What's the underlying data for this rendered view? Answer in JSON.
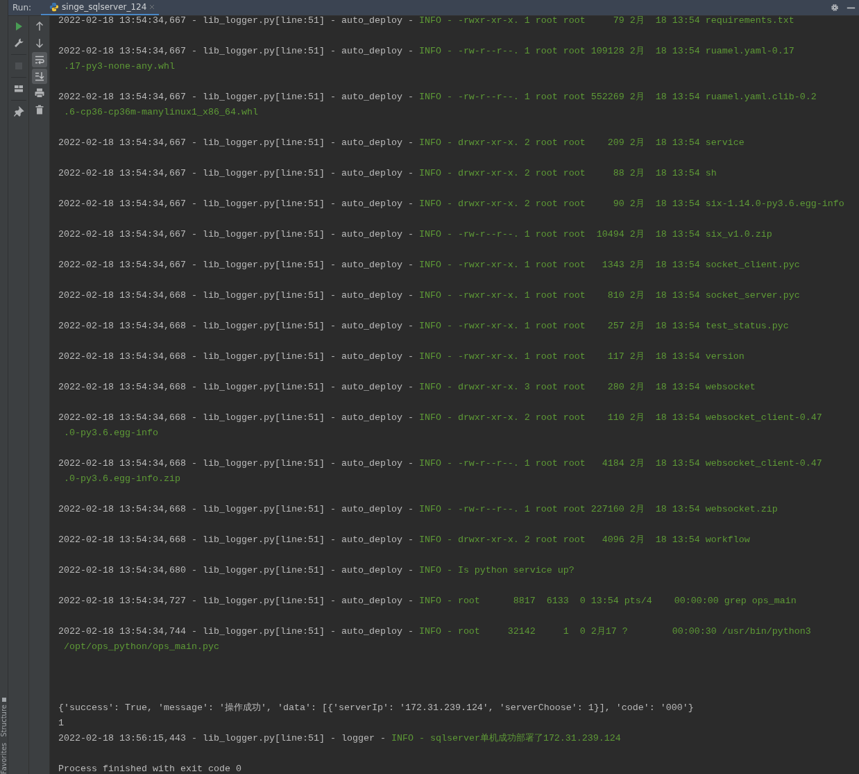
{
  "side_strip": {
    "items": [
      {
        "label": "Structure"
      },
      {
        "label": "Favorites"
      }
    ]
  },
  "run_bar": {
    "label": "Run:",
    "tabs": [
      {
        "label": "singe_sqlserver_124",
        "selected": true,
        "closable": true
      }
    ],
    "actions": [
      {
        "kind": "settings"
      },
      {
        "kind": "minimize"
      }
    ]
  },
  "toolbar_left": [
    {
      "kind": "rerun",
      "disabled": false
    },
    {
      "kind": "wrench",
      "disabled": false
    },
    {
      "kind": "stop",
      "disabled": true
    },
    {
      "kind": "layout",
      "disabled": false
    },
    {
      "kind": "pin",
      "disabled": false
    }
  ],
  "toolbar_right": [
    {
      "kind": "up",
      "on": false
    },
    {
      "kind": "down",
      "on": false
    },
    {
      "kind": "wrap",
      "on": true
    },
    {
      "kind": "scroll-end",
      "on": true
    },
    {
      "kind": "print",
      "on": false
    },
    {
      "kind": "delete",
      "on": false
    }
  ],
  "console": {
    "lines": [
      {
        "kind": "log",
        "prefix": "2022-02-18 13:54:34,667 - lib_logger.py[line:51] - auto_deploy - ",
        "message": "INFO - -rwxr-xr-x. 1 root root     79 2月  18 13:54 requirements.txt"
      },
      {
        "kind": "blank"
      },
      {
        "kind": "log",
        "prefix": "2022-02-18 13:54:34,667 - lib_logger.py[line:51] - auto_deploy - ",
        "message": "INFO - -rw-r--r--. 1 root root 109128 2月  18 13:54 ruamel.yaml-0.17"
      },
      {
        "kind": "wrap",
        "text": ".17-py3-none-any.whl"
      },
      {
        "kind": "blank"
      },
      {
        "kind": "log",
        "prefix": "2022-02-18 13:54:34,667 - lib_logger.py[line:51] - auto_deploy - ",
        "message": "INFO - -rw-r--r--. 1 root root 552269 2月  18 13:54 ruamel.yaml.clib-0.2"
      },
      {
        "kind": "wrap",
        "text": ".6-cp36-cp36m-manylinux1_x86_64.whl"
      },
      {
        "kind": "blank"
      },
      {
        "kind": "log",
        "prefix": "2022-02-18 13:54:34,667 - lib_logger.py[line:51] - auto_deploy - ",
        "message": "INFO - drwxr-xr-x. 2 root root    209 2月  18 13:54 service"
      },
      {
        "kind": "blank"
      },
      {
        "kind": "log",
        "prefix": "2022-02-18 13:54:34,667 - lib_logger.py[line:51] - auto_deploy - ",
        "message": "INFO - drwxr-xr-x. 2 root root     88 2月  18 13:54 sh"
      },
      {
        "kind": "blank"
      },
      {
        "kind": "log",
        "prefix": "2022-02-18 13:54:34,667 - lib_logger.py[line:51] - auto_deploy - ",
        "message": "INFO - drwxr-xr-x. 2 root root     90 2月  18 13:54 six-1.14.0-py3.6.egg-info"
      },
      {
        "kind": "blank"
      },
      {
        "kind": "log",
        "prefix": "2022-02-18 13:54:34,667 - lib_logger.py[line:51] - auto_deploy - ",
        "message": "INFO - -rw-r--r--. 1 root root  10494 2月  18 13:54 six_v1.0.zip"
      },
      {
        "kind": "blank"
      },
      {
        "kind": "log",
        "prefix": "2022-02-18 13:54:34,667 - lib_logger.py[line:51] - auto_deploy - ",
        "message": "INFO - -rwxr-xr-x. 1 root root   1343 2月  18 13:54 socket_client.pyc"
      },
      {
        "kind": "blank"
      },
      {
        "kind": "log",
        "prefix": "2022-02-18 13:54:34,668 - lib_logger.py[line:51] - auto_deploy - ",
        "message": "INFO - -rwxr-xr-x. 1 root root    810 2月  18 13:54 socket_server.pyc"
      },
      {
        "kind": "blank"
      },
      {
        "kind": "log",
        "prefix": "2022-02-18 13:54:34,668 - lib_logger.py[line:51] - auto_deploy - ",
        "message": "INFO - -rwxr-xr-x. 1 root root    257 2月  18 13:54 test_status.pyc"
      },
      {
        "kind": "blank"
      },
      {
        "kind": "log",
        "prefix": "2022-02-18 13:54:34,668 - lib_logger.py[line:51] - auto_deploy - ",
        "message": "INFO - -rwxr-xr-x. 1 root root    117 2月  18 13:54 version"
      },
      {
        "kind": "blank"
      },
      {
        "kind": "log",
        "prefix": "2022-02-18 13:54:34,668 - lib_logger.py[line:51] - auto_deploy - ",
        "message": "INFO - drwxr-xr-x. 3 root root    280 2月  18 13:54 websocket"
      },
      {
        "kind": "blank"
      },
      {
        "kind": "log",
        "prefix": "2022-02-18 13:54:34,668 - lib_logger.py[line:51] - auto_deploy - ",
        "message": "INFO - drwxr-xr-x. 2 root root    110 2月  18 13:54 websocket_client-0.47"
      },
      {
        "kind": "wrap",
        "text": ".0-py3.6.egg-info"
      },
      {
        "kind": "blank"
      },
      {
        "kind": "log",
        "prefix": "2022-02-18 13:54:34,668 - lib_logger.py[line:51] - auto_deploy - ",
        "message": "INFO - -rw-r--r--. 1 root root   4184 2月  18 13:54 websocket_client-0.47"
      },
      {
        "kind": "wrap",
        "text": ".0-py3.6.egg-info.zip"
      },
      {
        "kind": "blank"
      },
      {
        "kind": "log",
        "prefix": "2022-02-18 13:54:34,668 - lib_logger.py[line:51] - auto_deploy - ",
        "message": "INFO - -rw-r--r--. 1 root root 227160 2月  18 13:54 websocket.zip"
      },
      {
        "kind": "blank"
      },
      {
        "kind": "log",
        "prefix": "2022-02-18 13:54:34,668 - lib_logger.py[line:51] - auto_deploy - ",
        "message": "INFO - drwxr-xr-x. 2 root root   4096 2月  18 13:54 workflow"
      },
      {
        "kind": "blank"
      },
      {
        "kind": "log",
        "prefix": "2022-02-18 13:54:34,680 - lib_logger.py[line:51] - auto_deploy - ",
        "message": "INFO - Is python service up?"
      },
      {
        "kind": "blank"
      },
      {
        "kind": "log",
        "prefix": "2022-02-18 13:54:34,727 - lib_logger.py[line:51] - auto_deploy - ",
        "message": "INFO - root      8817  6133  0 13:54 pts/4    00:00:00 grep ops_main"
      },
      {
        "kind": "blank"
      },
      {
        "kind": "log",
        "prefix": "2022-02-18 13:54:34,744 - lib_logger.py[line:51] - auto_deploy - ",
        "message": "INFO - root     32142     1  0 2月17 ?        00:00:30 /usr/bin/python3"
      },
      {
        "kind": "wrap",
        "text": "/opt/ops_python/ops_main.pyc"
      },
      {
        "kind": "blank"
      },
      {
        "kind": "blank"
      },
      {
        "kind": "blank"
      },
      {
        "kind": "plain",
        "text": "{'success': True, 'message': '操作成功', 'data': [{'serverIp': '172.31.239.124', 'serverChoose': 1}], 'code': '000'}"
      },
      {
        "kind": "plain",
        "text": "1"
      },
      {
        "kind": "log",
        "prefix": "2022-02-18 13:56:15,443 - lib_logger.py[line:51] - logger - ",
        "message": "INFO - sqlserver单机成功部署了172.31.239.124"
      },
      {
        "kind": "blank"
      },
      {
        "kind": "plain",
        "text": "Process finished with exit code 0"
      }
    ]
  }
}
